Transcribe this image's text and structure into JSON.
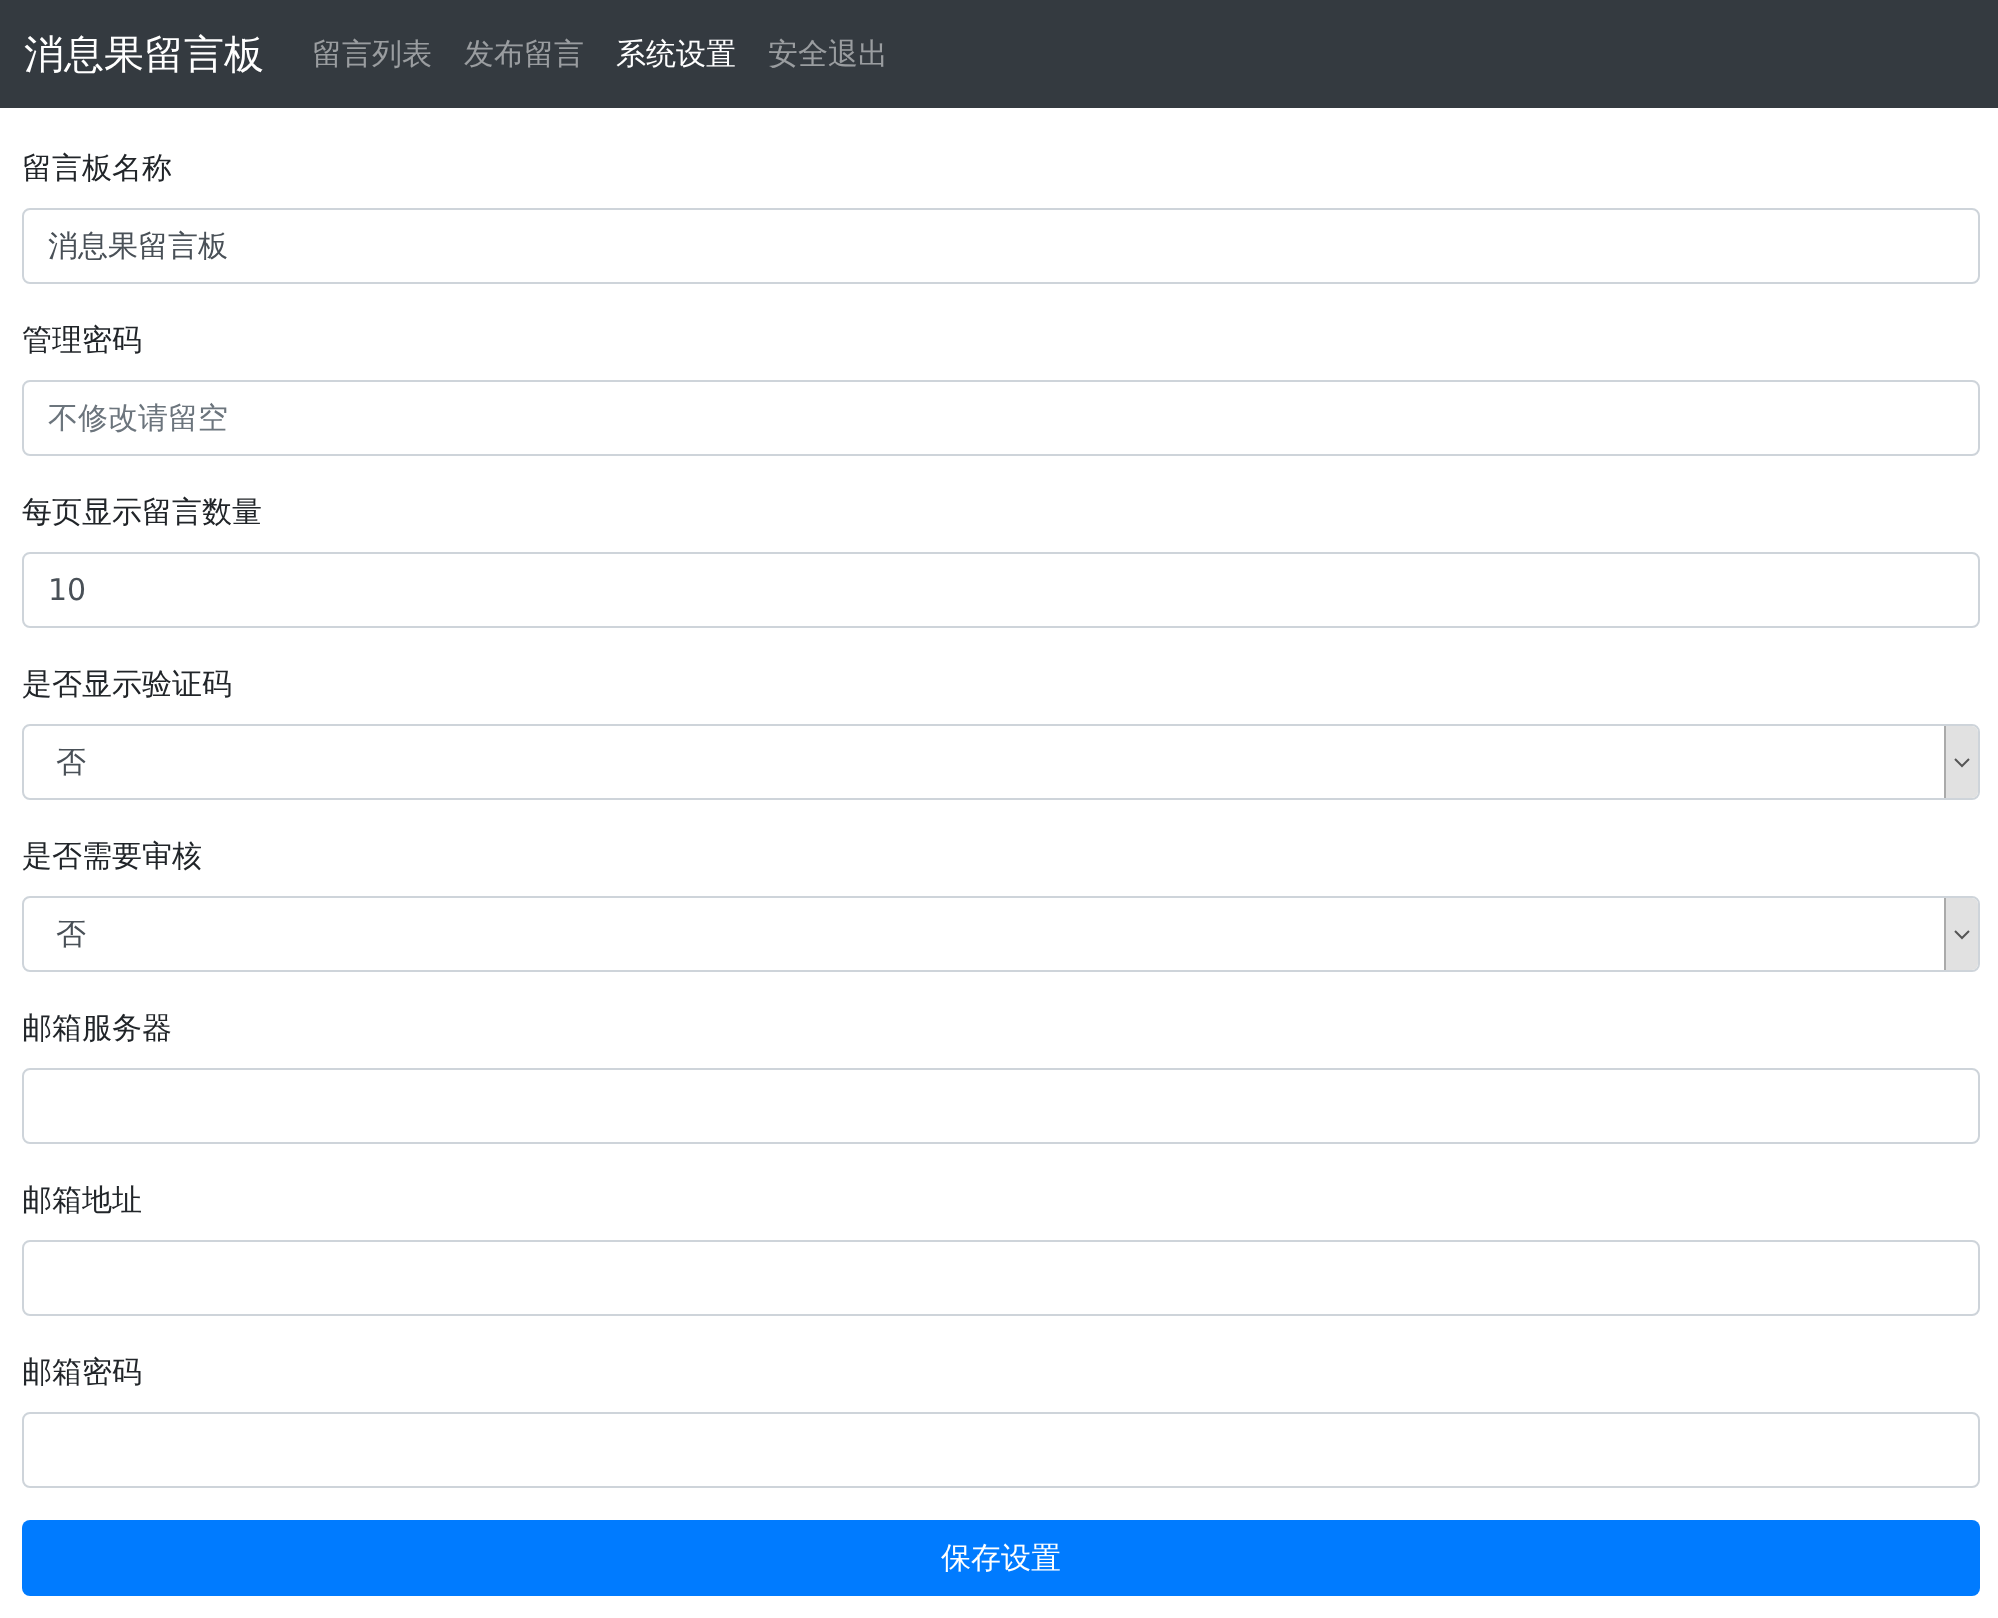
{
  "navbar": {
    "brand": "消息果留言板",
    "links": [
      {
        "label": "留言列表",
        "selected": false
      },
      {
        "label": "发布留言",
        "selected": false
      },
      {
        "label": "系统设置",
        "selected": true
      },
      {
        "label": "安全退出",
        "selected": false
      }
    ]
  },
  "form": {
    "fields": [
      {
        "kind": "text",
        "label": "留言板名称",
        "value": "消息果留言板"
      },
      {
        "kind": "text",
        "label": "管理密码",
        "placeholder": "不修改请留空"
      },
      {
        "kind": "text",
        "label": "每页显示留言数量",
        "value": "10"
      },
      {
        "kind": "select",
        "label": "是否显示验证码",
        "value": "否"
      },
      {
        "kind": "select",
        "label": "是否需要审核",
        "value": "否"
      },
      {
        "kind": "text",
        "label": "邮箱服务器"
      },
      {
        "kind": "text",
        "label": "邮箱地址"
      },
      {
        "kind": "text",
        "label": "邮箱密码"
      }
    ],
    "submit": "保存设置"
  }
}
